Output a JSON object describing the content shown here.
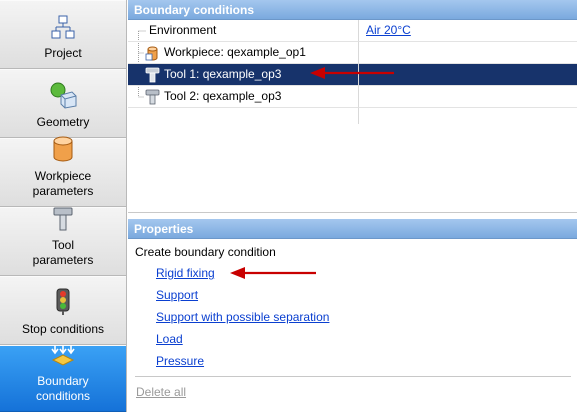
{
  "nav": {
    "items": [
      {
        "label": "Project",
        "icon": "project-tree-icon"
      },
      {
        "label": "Geometry",
        "icon": "geometry-shapes-icon"
      },
      {
        "label": "Workpiece\nparameters",
        "icon": "workpiece-cylinder-icon"
      },
      {
        "label": "Tool\nparameters",
        "icon": "tool-hammer-icon"
      },
      {
        "label": "Stop conditions",
        "icon": "traffic-light-icon"
      },
      {
        "label": "Boundary\nconditions",
        "icon": "boundary-arrows-icon"
      }
    ],
    "active": "Boundary\nconditions"
  },
  "boundary_panel": {
    "title": "Boundary conditions",
    "rows": [
      {
        "name": "Environment",
        "value": "Air 20°C",
        "icon": ""
      },
      {
        "name": "Workpiece: qexample_op1",
        "value": "",
        "icon": "workpiece-small-icon"
      },
      {
        "name": "Tool 1: qexample_op3",
        "value": "",
        "icon": "tool-small-icon",
        "selected": true
      },
      {
        "name": "Tool 2: qexample_op3",
        "value": "",
        "icon": "tool-small-icon"
      }
    ]
  },
  "properties_panel": {
    "title": "Properties",
    "heading": "Create boundary condition",
    "links": [
      "Rigid fixing",
      "Support",
      "Support with possible separation",
      "Load",
      "Pressure"
    ],
    "delete_all": "Delete all"
  },
  "colors": {
    "selection": "#17336b",
    "link": "#0a3fd0",
    "header": "#8fb8e8",
    "annotation_arrow": "#c80000",
    "active_nav": "#1f86e6"
  }
}
